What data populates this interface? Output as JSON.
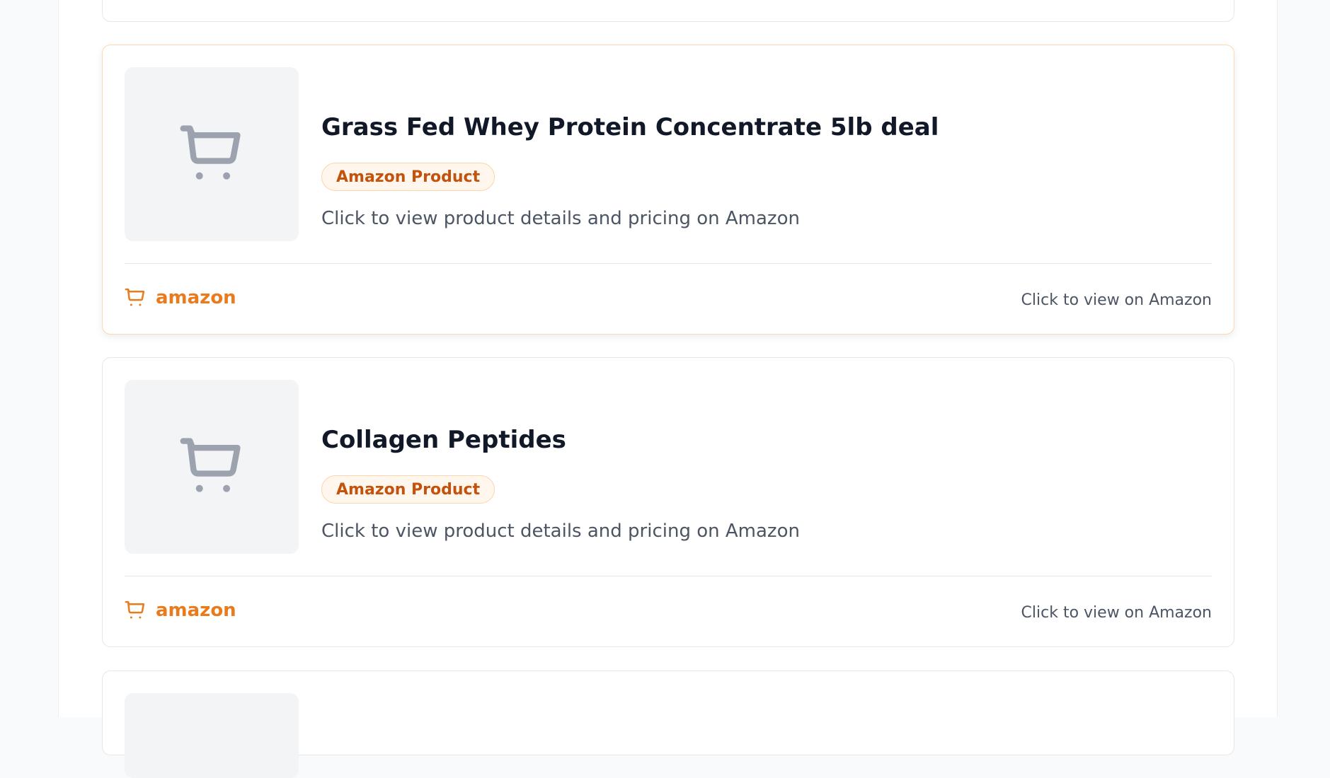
{
  "colors": {
    "accent": "#ea7b1c",
    "badge_text": "#c2520c",
    "badge_bg": "#fff7ed",
    "thumb_bg": "#f3f4f6",
    "icon_gray": "#9ca3af"
  },
  "products": [
    {
      "title": "Grass Fed Whey Protein Concentrate 5lb deal",
      "badge": "Amazon Product",
      "description": "Click to view product details and pricing on Amazon",
      "brand": "amazon",
      "link_text": "Click to view on Amazon",
      "thumbnail_icon": "shopping-cart-icon",
      "brand_icon": "shopping-cart-icon"
    },
    {
      "title": "Collagen Peptides",
      "badge": "Amazon Product",
      "description": "Click to view product details and pricing on Amazon",
      "brand": "amazon",
      "link_text": "Click to view on Amazon",
      "thumbnail_icon": "shopping-cart-icon",
      "brand_icon": "shopping-cart-icon"
    }
  ]
}
